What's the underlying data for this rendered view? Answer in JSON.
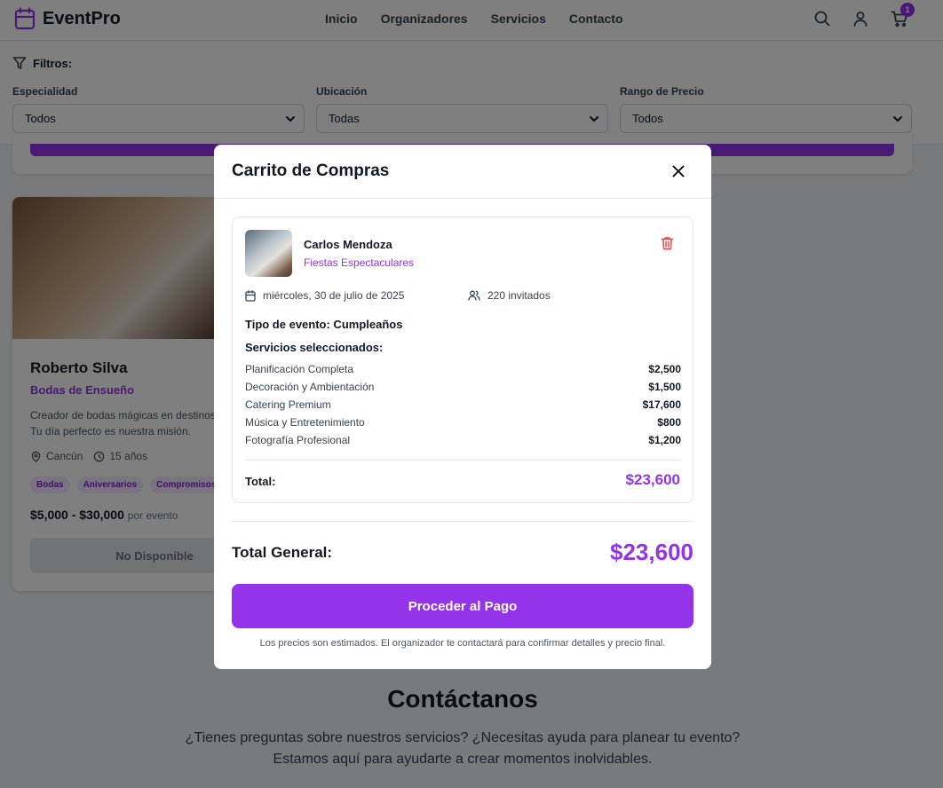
{
  "header": {
    "brand": "EventPro",
    "nav": [
      "Inicio",
      "Organizadores",
      "Servicios",
      "Contacto"
    ],
    "cart_count": "1"
  },
  "filters": {
    "title": "Filtros:",
    "fields": [
      {
        "label": "Especialidad",
        "value": "Todos"
      },
      {
        "label": "Ubicación",
        "value": "Todas"
      },
      {
        "label": "Rango de Precio",
        "value": "Todos"
      }
    ]
  },
  "card": {
    "name": "Roberto Silva",
    "company": "Bodas de Ensueño",
    "description": "Creador de bodas mágicas en destinos p",
    "description_2": "Tu día perfecto es nuestra misión.",
    "location": "Cancún",
    "experience": "15 años",
    "tags": [
      "Bodas",
      "Aniversarios",
      "Compromisos"
    ],
    "price": "$5,000 - $30,000",
    "price_suffix": "por evento",
    "button": "No Disponible"
  },
  "contact": {
    "title": "Contáctanos",
    "line1": "¿Tienes preguntas sobre nuestros servicios? ¿Necesitas ayuda para planear tu evento?",
    "line2": "Estamos aquí para ayudarte a crear momentos inolvidables."
  },
  "modal": {
    "title": "Carrito de Compras",
    "item": {
      "organizer": "Carlos Mendoza",
      "company": "Fiestas Espectaculares",
      "date": "miércoles, 30 de julio de 2025",
      "guests": "220 invitados",
      "event_type": "Tipo de evento: Cumpleaños",
      "services_title": "Servicios seleccionados:",
      "services": [
        {
          "name": "Planificación Completa",
          "price": "$2,500"
        },
        {
          "name": "Decoración y Ambientación",
          "price": "$1,500"
        },
        {
          "name": "Catering Premium",
          "price": "$17,600"
        },
        {
          "name": "Música y Entretenimiento",
          "price": "$800"
        },
        {
          "name": "Fotografía Profesional",
          "price": "$1,200"
        }
      ],
      "total_label": "Total:",
      "total": "$23,600"
    },
    "grand_total_label": "Total General:",
    "grand_total": "$23,600",
    "pay_button": "Proceder al Pago",
    "disclaimer": "Los precios son estimados. El organizador te contactará para confirmar detalles y precio final."
  },
  "colors": {
    "accent": "#9333ea",
    "danger": "#ef4444",
    "overlay": "rgba(0,0,0,0.5)"
  }
}
